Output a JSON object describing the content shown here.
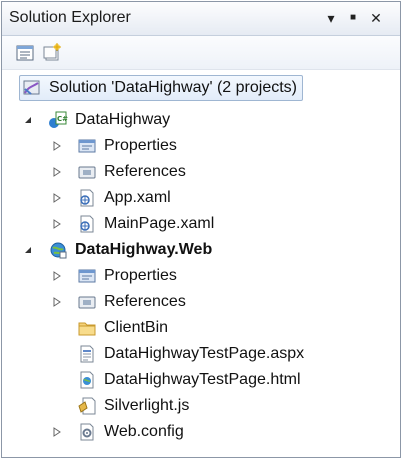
{
  "window": {
    "title": "Solution Explorer",
    "buttons": {
      "dropdown": "▾",
      "pin": "■",
      "close": "✕"
    }
  },
  "toolbar": {
    "items": [
      {
        "name": "properties-icon"
      },
      {
        "name": "show-all-files-icon"
      }
    ]
  },
  "tree": {
    "solution": "Solution 'DataHighway' (2 projects)",
    "projects": [
      {
        "name": "DataHighway",
        "bold": false,
        "icon": "csharp-project-icon",
        "items": [
          {
            "label": "Properties",
            "icon": "properties-folder-icon",
            "expandable": true
          },
          {
            "label": "References",
            "icon": "references-folder-icon",
            "expandable": true
          },
          {
            "label": "App.xaml",
            "icon": "xaml-file-icon",
            "expandable": true
          },
          {
            "label": "MainPage.xaml",
            "icon": "xaml-file-icon",
            "expandable": true
          }
        ]
      },
      {
        "name": "DataHighway.Web",
        "bold": true,
        "icon": "web-project-icon",
        "items": [
          {
            "label": "Properties",
            "icon": "properties-folder-icon",
            "expandable": true
          },
          {
            "label": "References",
            "icon": "references-folder-icon",
            "expandable": true
          },
          {
            "label": "ClientBin",
            "icon": "folder-icon",
            "expandable": false
          },
          {
            "label": "DataHighwayTestPage.aspx",
            "icon": "aspx-file-icon",
            "expandable": false
          },
          {
            "label": "DataHighwayTestPage.html",
            "icon": "html-file-icon",
            "expandable": false
          },
          {
            "label": "Silverlight.js",
            "icon": "js-file-icon",
            "expandable": false
          },
          {
            "label": "Web.config",
            "icon": "config-file-icon",
            "expandable": true
          }
        ]
      }
    ]
  },
  "colors": {
    "selection_border": "#9fb6d2",
    "selection_fill": "#e2ecf9",
    "frame": "#8c97a7"
  }
}
